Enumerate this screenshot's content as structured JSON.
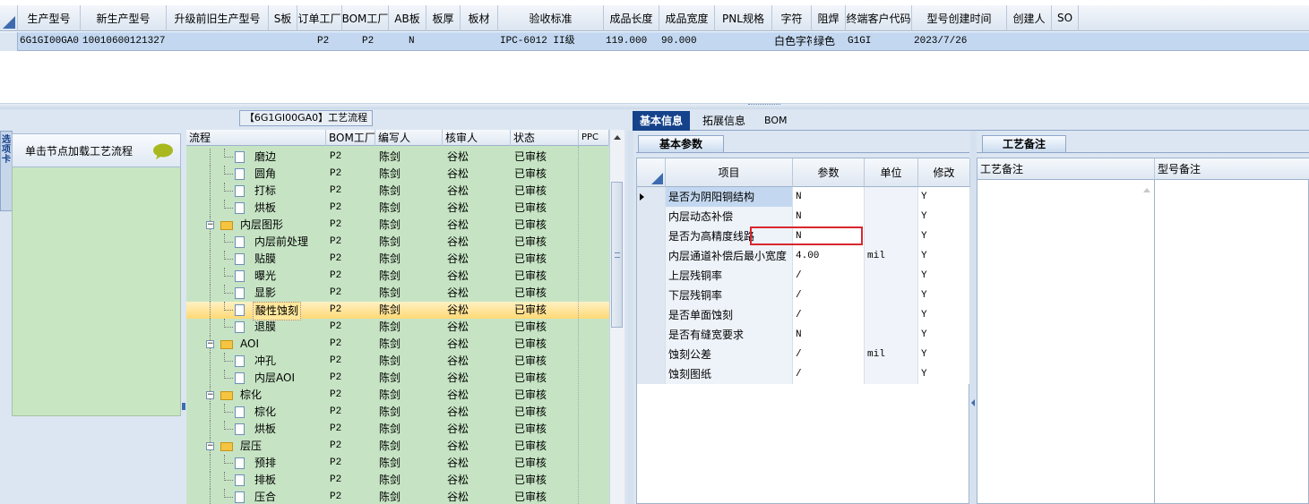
{
  "top_grid": {
    "columns": [
      "生产型号",
      "新生产型号",
      "升级前旧生产型号",
      "S板",
      "订单工厂",
      "BOM工厂",
      "AB板",
      "板厚",
      "板材",
      "验收标准",
      "成品长度",
      "成品宽度",
      "PNL规格",
      "字符",
      "阻焊",
      "终端客户代码",
      "型号创建时间",
      "创建人",
      "SO"
    ],
    "row": [
      "6G1GI00GA0",
      "10010600121327",
      "",
      "",
      "P2",
      "P2",
      "N",
      "",
      "",
      "IPC-6012 II级",
      "119.000",
      "90.000",
      "",
      "白色字符",
      "绿色",
      "G1GI",
      "2023/7/26",
      "",
      ""
    ]
  },
  "left_panel": {
    "tab_label": "选项卡",
    "card_title": "单击节点加载工艺流程",
    "bubble_icon": "speech-bubble-icon"
  },
  "tree": {
    "title": "【6G1GI00GA0】工艺流程",
    "headers": [
      "流程",
      "BOM工厂",
      "编写人",
      "核审人",
      "状态",
      "PPC"
    ],
    "rows": [
      {
        "name": "磨边",
        "type": "file",
        "level": 2,
        "bom": "P2",
        "writer": "陈剑",
        "reviewer": "谷松",
        "status": "已审核",
        "selected": false
      },
      {
        "name": "圆角",
        "type": "file",
        "level": 2,
        "bom": "P2",
        "writer": "陈剑",
        "reviewer": "谷松",
        "status": "已审核",
        "selected": false
      },
      {
        "name": "打标",
        "type": "file",
        "level": 2,
        "bom": "P2",
        "writer": "陈剑",
        "reviewer": "谷松",
        "status": "已审核",
        "selected": false
      },
      {
        "name": "烘板",
        "type": "file",
        "level": 2,
        "bom": "P2",
        "writer": "陈剑",
        "reviewer": "谷松",
        "status": "已审核",
        "selected": false
      },
      {
        "name": "内层图形",
        "type": "folder",
        "level": 1,
        "bom": "P2",
        "writer": "陈剑",
        "reviewer": "谷松",
        "status": "已审核",
        "selected": false
      },
      {
        "name": "内层前处理",
        "type": "file",
        "level": 2,
        "bom": "P2",
        "writer": "陈剑",
        "reviewer": "谷松",
        "status": "已审核",
        "selected": false
      },
      {
        "name": "贴膜",
        "type": "file",
        "level": 2,
        "bom": "P2",
        "writer": "陈剑",
        "reviewer": "谷松",
        "status": "已审核",
        "selected": false
      },
      {
        "name": "曝光",
        "type": "file",
        "level": 2,
        "bom": "P2",
        "writer": "陈剑",
        "reviewer": "谷松",
        "status": "已审核",
        "selected": false
      },
      {
        "name": "显影",
        "type": "file",
        "level": 2,
        "bom": "P2",
        "writer": "陈剑",
        "reviewer": "谷松",
        "status": "已审核",
        "selected": false
      },
      {
        "name": "酸性蚀刻",
        "type": "file",
        "level": 2,
        "bom": "P2",
        "writer": "陈剑",
        "reviewer": "谷松",
        "status": "已审核",
        "selected": true
      },
      {
        "name": "退膜",
        "type": "file",
        "level": 2,
        "bom": "P2",
        "writer": "陈剑",
        "reviewer": "谷松",
        "status": "已审核",
        "selected": false
      },
      {
        "name": "AOI",
        "type": "folder",
        "level": 1,
        "bom": "P2",
        "writer": "陈剑",
        "reviewer": "谷松",
        "status": "已审核",
        "selected": false
      },
      {
        "name": "冲孔",
        "type": "file",
        "level": 2,
        "bom": "P2",
        "writer": "陈剑",
        "reviewer": "谷松",
        "status": "已审核",
        "selected": false
      },
      {
        "name": "内层AOI",
        "type": "file",
        "level": 2,
        "bom": "P2",
        "writer": "陈剑",
        "reviewer": "谷松",
        "status": "已审核",
        "selected": false
      },
      {
        "name": "棕化",
        "type": "folder",
        "level": 1,
        "bom": "P2",
        "writer": "陈剑",
        "reviewer": "谷松",
        "status": "已审核",
        "selected": false
      },
      {
        "name": "棕化",
        "type": "file",
        "level": 2,
        "bom": "P2",
        "writer": "陈剑",
        "reviewer": "谷松",
        "status": "已审核",
        "selected": false
      },
      {
        "name": "烘板",
        "type": "file",
        "level": 2,
        "bom": "P2",
        "writer": "陈剑",
        "reviewer": "谷松",
        "status": "已审核",
        "selected": false
      },
      {
        "name": "层压",
        "type": "folder",
        "level": 1,
        "bom": "P2",
        "writer": "陈剑",
        "reviewer": "谷松",
        "status": "已审核",
        "selected": false
      },
      {
        "name": "预排",
        "type": "file",
        "level": 2,
        "bom": "P2",
        "writer": "陈剑",
        "reviewer": "谷松",
        "status": "已审核",
        "selected": false
      },
      {
        "name": "排板",
        "type": "file",
        "level": 2,
        "bom": "P2",
        "writer": "陈剑",
        "reviewer": "谷松",
        "status": "已审核",
        "selected": false
      },
      {
        "name": "压合",
        "type": "file",
        "level": 2,
        "bom": "P2",
        "writer": "陈剑",
        "reviewer": "谷松",
        "status": "已审核",
        "selected": false
      }
    ]
  },
  "right_tabs": [
    "基本信息",
    "拓展信息",
    "BOM"
  ],
  "basic_params": {
    "tab_label": "基本参数",
    "headers": [
      "项目",
      "参数",
      "单位",
      "修改"
    ],
    "rows": [
      {
        "item": "是否为阴阳铜结构",
        "value": "N",
        "unit": "",
        "modify": "Y",
        "current": true
      },
      {
        "item": "内层动态补偿",
        "value": "N",
        "unit": "",
        "modify": "Y",
        "current": false
      },
      {
        "item": "是否为高精度线路",
        "value": "N",
        "unit": "",
        "modify": "Y",
        "current": false
      },
      {
        "item": "内层通道补偿后最小宽度",
        "value": "4.00",
        "unit": "mil",
        "modify": "Y",
        "current": false
      },
      {
        "item": "上层残铜率",
        "value": "/",
        "unit": "",
        "modify": "Y",
        "current": false
      },
      {
        "item": "下层残铜率",
        "value": "/",
        "unit": "",
        "modify": "Y",
        "current": false
      },
      {
        "item": "是否单面蚀刻",
        "value": "/",
        "unit": "",
        "modify": "Y",
        "current": false
      },
      {
        "item": "是否有缝宽要求",
        "value": "N",
        "unit": "",
        "modify": "Y",
        "current": false
      },
      {
        "item": "蚀刻公差",
        "value": "/",
        "unit": "mil",
        "modify": "Y",
        "current": false
      },
      {
        "item": "蚀刻图纸",
        "value": "/",
        "unit": "",
        "modify": "Y",
        "current": false
      }
    ]
  },
  "process_remarks": {
    "tab_label": "工艺备注",
    "headers": [
      "工艺备注",
      "型号备注"
    ]
  }
}
